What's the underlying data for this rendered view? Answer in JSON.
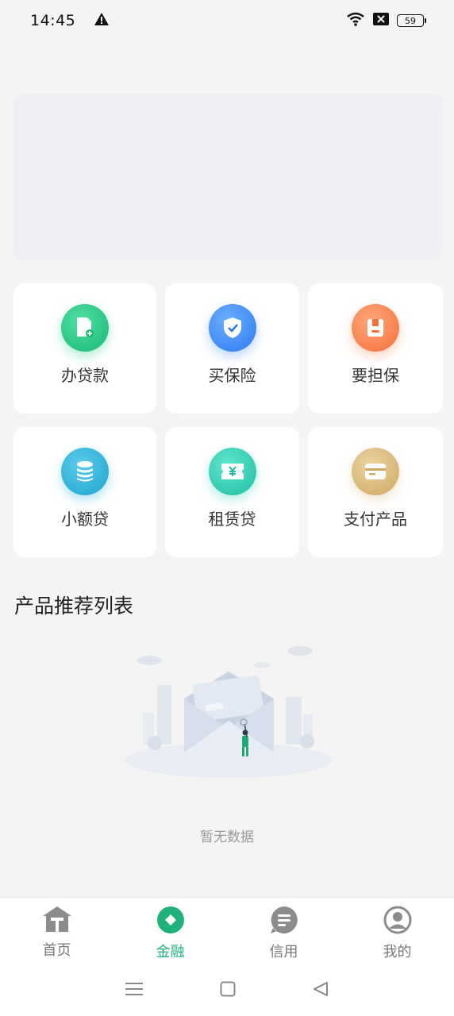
{
  "status_bar": {
    "time": "14:45",
    "battery": "59",
    "icons": [
      "warning-icon",
      "wifi-icon",
      "sim-off-icon",
      "battery-icon"
    ]
  },
  "services": [
    {
      "label": "办贷款",
      "icon": "loan-document-icon",
      "color": "#1ec885"
    },
    {
      "label": "买保险",
      "icon": "insurance-shield-icon",
      "color": "#3a8af7"
    },
    {
      "label": "要担保",
      "icon": "guarantee-icon",
      "color": "#fb7f45"
    },
    {
      "label": "小额贷",
      "icon": "coin-stack-icon",
      "color": "#27b3d8"
    },
    {
      "label": "租赁贷",
      "icon": "yen-ticket-icon",
      "color": "#2fcfb4"
    },
    {
      "label": "支付产品",
      "icon": "card-icon",
      "color": "#d8b97a"
    }
  ],
  "section": {
    "title": "产品推荐列表"
  },
  "empty_state": {
    "text": "暂无数据"
  },
  "tabbar": {
    "active_color": "#1fb27d",
    "items": [
      {
        "label": "首页",
        "icon": "home-icon"
      },
      {
        "label": "金融",
        "icon": "finance-icon"
      },
      {
        "label": "信用",
        "icon": "credit-icon"
      },
      {
        "label": "我的",
        "icon": "profile-icon"
      }
    ]
  },
  "system_nav": {
    "icons": [
      "menu-icon",
      "home-square-icon",
      "back-triangle-icon"
    ]
  }
}
